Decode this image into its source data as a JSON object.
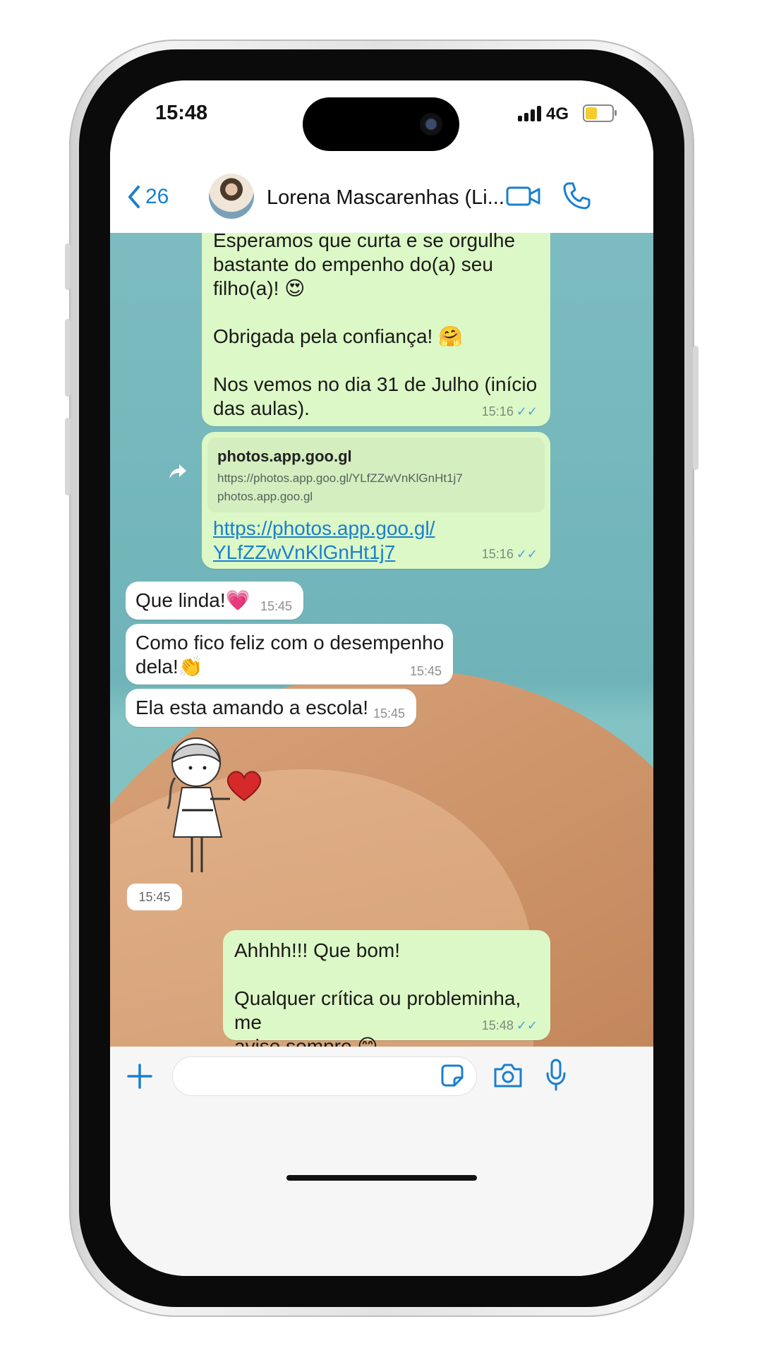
{
  "status_bar": {
    "time": "15:48",
    "network": "4G"
  },
  "header": {
    "back_count": "26",
    "contact_name": "Lorena Mascarenhas (Li..."
  },
  "messages": [
    {
      "id": "m1",
      "direction": "outgoing",
      "text": "Esperamos que curta e se orgulhe\nbastante do empenho do(a) seu\nfilho(a)! 😍\n\nObrigada pela confiança! 🤗\n\nNos vemos no dia 31 de Julho (início\ndas aulas).",
      "time": "15:16"
    },
    {
      "id": "m2",
      "direction": "outgoing",
      "link_title": "photos.app.goo.gl",
      "link_preview_url": "https://photos.app.goo.gl/YLfZZwVnKlGnHt1j7",
      "link_domain": "photos.app.goo.gl",
      "link": "https://photos.app.goo.gl/\nYLfZZwVnKlGnHt1j7",
      "time": "15:16"
    },
    {
      "id": "m3",
      "direction": "incoming",
      "text": "Que linda!💗",
      "time": "15:45"
    },
    {
      "id": "m4",
      "direction": "incoming",
      "text": "Como fico feliz com o desempenho\ndela!👏",
      "time": "15:45"
    },
    {
      "id": "m5",
      "direction": "incoming",
      "text": "Ela esta amando a escola!",
      "time": "15:45"
    },
    {
      "id": "m6",
      "direction": "incoming",
      "type": "sticker",
      "time": "15:45"
    },
    {
      "id": "m7",
      "direction": "outgoing",
      "text": "Ahhhh!!! Que bom!\n\nQualquer crítica ou probleminha, me\navise sempre 😊",
      "time": "15:48"
    }
  ],
  "icons": {
    "back": "chevron-left-icon",
    "video": "video-camera-icon",
    "call": "phone-icon",
    "forward": "forward-icon",
    "attach": "plus-icon",
    "sticker": "sticker-icon",
    "camera": "camera-icon",
    "mic": "microphone-icon"
  },
  "colors": {
    "accent": "#1a7fd0",
    "outgoing_bubble": "#dcf8c6",
    "incoming_bubble": "#ffffff",
    "read_ticks": "#4aa3df"
  }
}
